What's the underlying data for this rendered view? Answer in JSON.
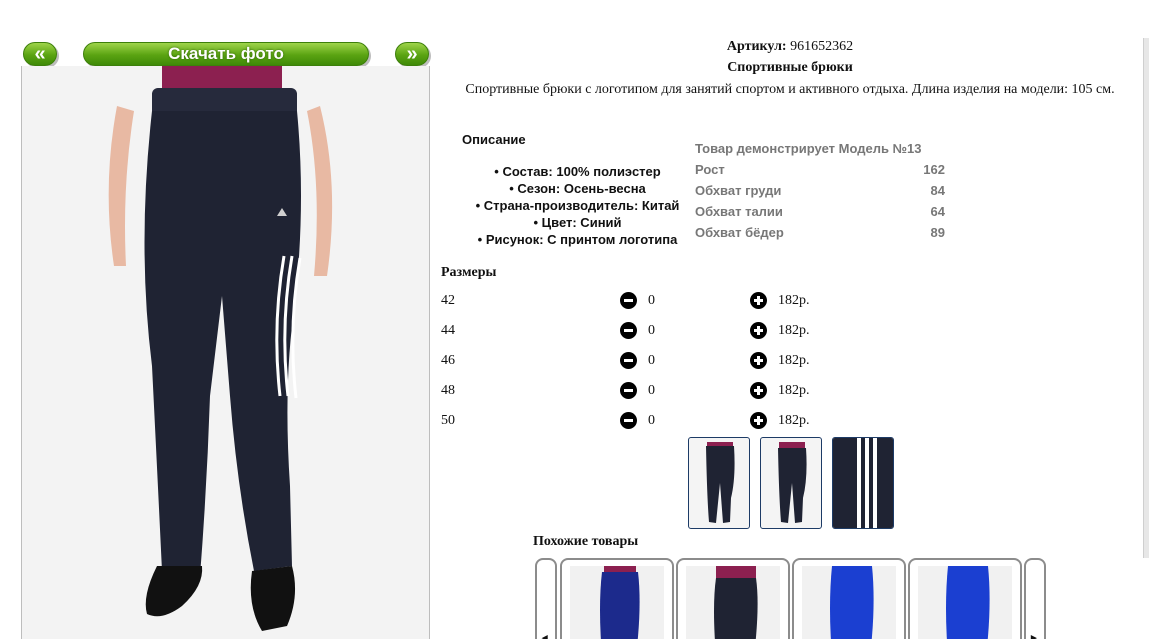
{
  "gallery": {
    "prev_label": "«",
    "next_label": "»",
    "download_label": "Скачать фото"
  },
  "product": {
    "article_label": "Артикул:",
    "article_value": "961652362",
    "title": "Спортивные брюки",
    "description": "Спортивные брюки с логотипом для занятий спортом и активного отдыха. Длина изделия на модели: 105 см."
  },
  "details": {
    "heading": "Описание",
    "properties": [
      "Состав: 100% полиэстер",
      "Сезон: Осень-весна",
      "Страна-производитель: Китай",
      "Цвет: Синий",
      "Рисунок: С принтом логотипа"
    ]
  },
  "model": {
    "heading": "Товар демонстрирует Модель №13",
    "rows": [
      {
        "label": "Рост",
        "value": "162"
      },
      {
        "label": "Обхват груди",
        "value": "84"
      },
      {
        "label": "Обхват талии",
        "value": "64"
      },
      {
        "label": "Обхват бёдер",
        "value": "89"
      }
    ]
  },
  "sizes": {
    "heading": "Размеры",
    "rows": [
      {
        "size": "42",
        "qty": "0",
        "price": "182р."
      },
      {
        "size": "44",
        "qty": "0",
        "price": "182р."
      },
      {
        "size": "46",
        "qty": "0",
        "price": "182р."
      },
      {
        "size": "48",
        "qty": "0",
        "price": "182р."
      },
      {
        "size": "50",
        "qty": "0",
        "price": "182р."
      }
    ]
  },
  "similar": {
    "heading": "Похожие товары"
  },
  "colors": {
    "button_green": "#5aa312",
    "pants_navy": "#1f2333",
    "shirt_magenta": "#8c2050",
    "pants_royal": "#1b3fd1"
  }
}
